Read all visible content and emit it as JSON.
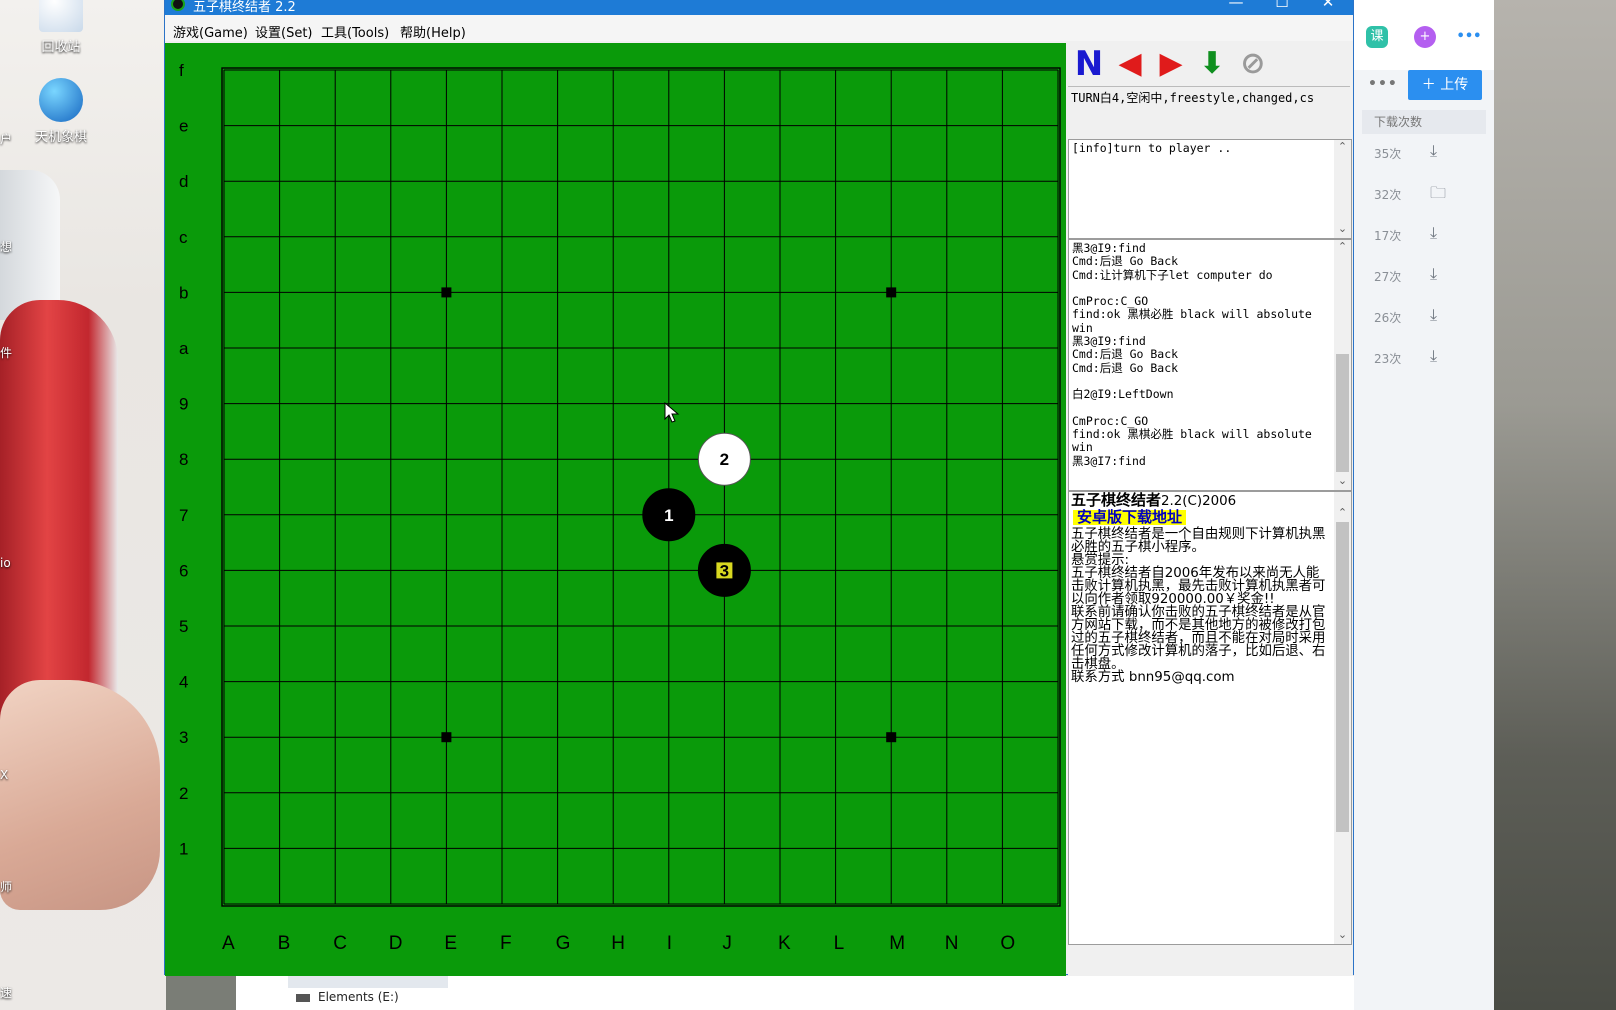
{
  "window": {
    "title": "五子棋终结者 2.2",
    "controls": {
      "minimize": "—",
      "maximize": "☐",
      "close": "✕"
    }
  },
  "menu": [
    "游戏(Game)",
    "设置(Set)",
    "工具(Tools)",
    "帮助(Help)"
  ],
  "board": {
    "columns": [
      "A",
      "B",
      "C",
      "D",
      "E",
      "F",
      "G",
      "H",
      "I",
      "J",
      "K",
      "L",
      "M",
      "N",
      "O"
    ],
    "rows": [
      "f",
      "e",
      "d",
      "c",
      "b",
      "a",
      "9",
      "8",
      "7",
      "6",
      "5",
      "4",
      "3",
      "2",
      "1"
    ],
    "star_points": [
      [
        "D",
        "c"
      ],
      [
        "L",
        "c"
      ],
      [
        "D",
        "4"
      ],
      [
        "L",
        "4"
      ]
    ],
    "stones": [
      {
        "label": "1",
        "color": "black",
        "col": "H",
        "row": "8"
      },
      {
        "label": "2",
        "color": "white",
        "col": "I",
        "row": "9"
      },
      {
        "label": "3",
        "color": "black",
        "col": "I",
        "row": "7",
        "highlight": true
      }
    ],
    "colors": {
      "board": "#0a9a0a",
      "grid": "#000000",
      "highlight": "#d8d820"
    }
  },
  "toolbar": [
    {
      "name": "new-game-button",
      "glyph": "N",
      "color": "#1a1ad0"
    },
    {
      "name": "back-button",
      "glyph": "◀",
      "color": "#e01b1b"
    },
    {
      "name": "forward-button",
      "glyph": "▶",
      "color": "#e01b1b"
    },
    {
      "name": "computer-move-button",
      "glyph": "⬇",
      "color": "#0f8f1f"
    },
    {
      "name": "stop-button",
      "glyph": "⊘",
      "color": "#9a9a9a"
    }
  ],
  "status": "TURN白4,空闲中,freestyle,changed,cs",
  "info_log": "[info]turn to player ..",
  "command_log": [
    "黑3@I9:find",
    "Cmd:后退 Go Back",
    "Cmd:让计算机下子let computer do",
    "",
    "CmProc:C_GO",
    "find:ok 黑棋必胜 black will absolute",
    "win",
    "黑3@I9:find",
    "Cmd:后退 Go Back",
    "Cmd:后退 Go Back",
    "",
    "白2@I9:LeftDown",
    "",
    "CmProc:C_GO",
    "find:ok 黑棋必胜 black will absolute",
    "win",
    "黑3@I7:find"
  ],
  "about": {
    "title": "五子棋终结者",
    "version": "2.2(C)2006",
    "android_link": "安卓版下载地址",
    "paragraphs": [
      "五子棋终结者是一个自由规则下计算机执黑必胜的五子棋小程序。",
      "悬赏提示:",
      "五子棋终结者自2006年发布以来尚无人能击败计算机执黑，最先击败计算机执黑者可以向作者领取920000.00￥奖金!!",
      "联系前请确认你击败的五子棋终结者是从官方网站下载，而不是其他地方的被修改打包过的五子棋终结者，而且不能在对局时采用任何方式修改计算机的落子，比如后退、右击棋盘。",
      "联系方式 bnn95@qq.com"
    ]
  },
  "desktop": {
    "icons": [
      "回收站",
      "天机象棋"
    ],
    "edge_labels": [
      "户",
      "想",
      "件",
      "io",
      "X",
      "师",
      "速"
    ]
  },
  "client_panel": {
    "top_icons": [
      "课",
      "+",
      "•••"
    ],
    "upload_label": "上传",
    "more": "•••",
    "column_header": "下载次数",
    "rows": [
      {
        "count": "35次",
        "icon": "download-icon"
      },
      {
        "count": "32次",
        "icon": "folder-icon"
      },
      {
        "count": "17次",
        "icon": "download-icon"
      },
      {
        "count": "27次",
        "icon": "download-icon"
      },
      {
        "count": "26次",
        "icon": "download-icon"
      },
      {
        "count": "23次",
        "icon": "download-icon"
      }
    ]
  },
  "explorer": {
    "drive_label": "Elements (E:)"
  }
}
